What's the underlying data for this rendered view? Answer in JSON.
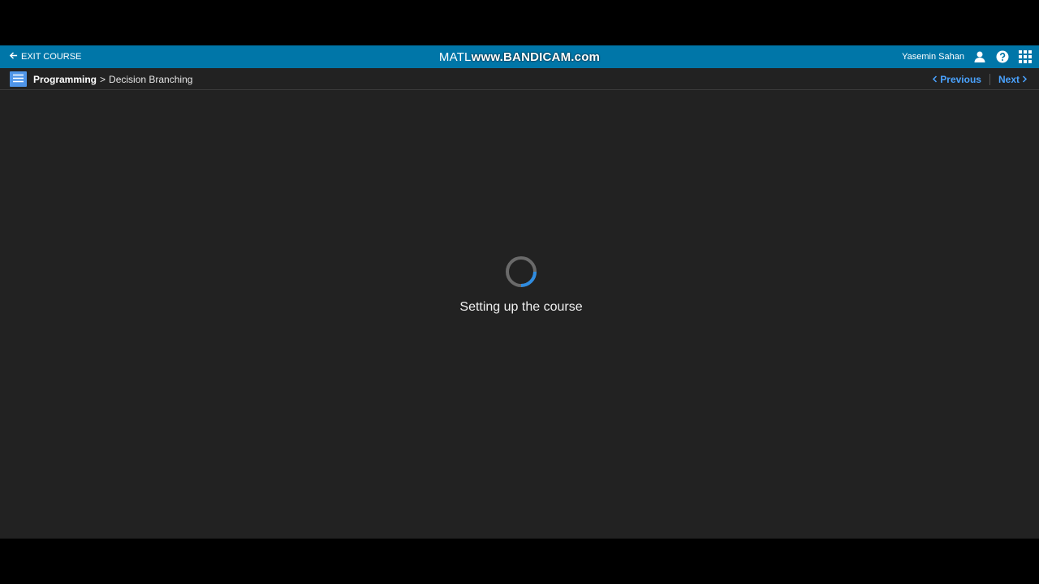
{
  "topbar": {
    "exit_label": "EXIT COURSE",
    "center_title": "MATL",
    "watermark": "www.BANDICAM.com",
    "user_name": "Yasemin Sahan"
  },
  "icons": {
    "exit": "arrow-left-icon",
    "user": "user-icon",
    "help": "help-icon",
    "apps": "apps-grid-icon",
    "toc": "table-of-contents-icon"
  },
  "breadcrumb": {
    "course": "Programming",
    "separator": ">",
    "lesson": "Decision Branching"
  },
  "nav": {
    "previous_label": "Previous",
    "next_label": "Next"
  },
  "status": {
    "loading_text": "Setting up the course"
  },
  "colors": {
    "topbar": "#0076a8",
    "background": "#222222",
    "accent": "#4aa3ff",
    "spinner": "#2f8ce0"
  }
}
